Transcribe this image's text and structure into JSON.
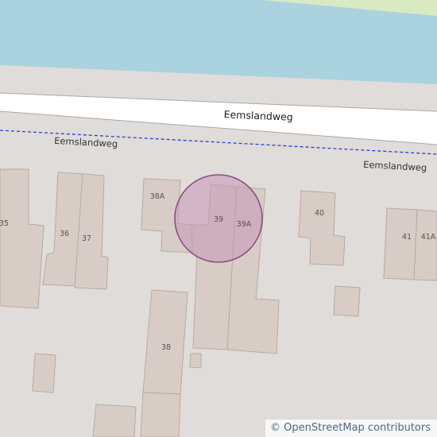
{
  "map": {
    "colors": {
      "water": "#aad3df",
      "park": "#d9e9c2",
      "land": "#dfdcd9",
      "road": "#ffffff",
      "road_casing": "#a9a8a6",
      "path_dash": "#2a3fd1",
      "building": "#d8cdc6",
      "building_stroke": "#b9aaa1",
      "highlight_fill": "#c698b8",
      "highlight_stroke": "#8a4f7f"
    },
    "road_labels": {
      "main": "Eemslandweg",
      "north_left": "Eemslandweg",
      "north_right": "Eemslandweg"
    },
    "house_numbers": {
      "n35": "35",
      "n36": "36",
      "n37": "37",
      "n38a": "38A",
      "n39": "39",
      "n39a": "39A",
      "n40": "40",
      "n41": "41",
      "n41a": "41A",
      "n38": "38"
    }
  },
  "attribution": {
    "symbol": "©",
    "text": "OpenStreetMap contributors"
  }
}
